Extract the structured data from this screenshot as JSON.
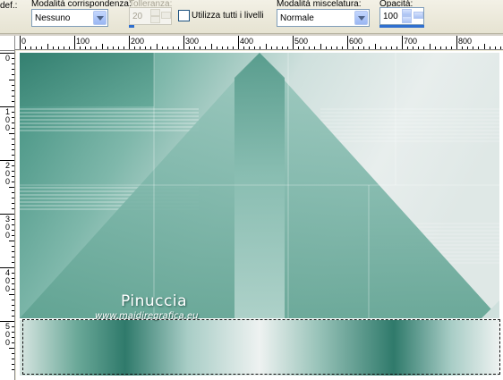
{
  "toolbar": {
    "partial_left_label": "def.:",
    "match_mode": {
      "label": "Modalità corrispondenza:",
      "value": "Nessuno"
    },
    "tolerance": {
      "label": "Tolleranza:",
      "value": "20",
      "enabled": false
    },
    "use_all_layers": {
      "label": "Utilizza tutti i livelli",
      "checked": false
    },
    "blend_mode": {
      "label": "Modalità miscelatura:",
      "value": "Normale"
    },
    "opacity": {
      "label": "Opacità:",
      "value": "100"
    }
  },
  "ruler_h": {
    "labels": [
      "0",
      "100",
      "200",
      "300",
      "400",
      "500",
      "600",
      "700",
      "800"
    ]
  },
  "ruler_v": {
    "labels": [
      [
        "0"
      ],
      [
        "1",
        "0",
        "0"
      ],
      [
        "2",
        "0",
        "0"
      ],
      [
        "3",
        "0",
        "0"
      ],
      [
        "4",
        "0",
        "0"
      ],
      [
        "5",
        "0",
        "0"
      ]
    ]
  },
  "canvas": {
    "watermark_name": "Pinuccia",
    "watermark_url": "www.maidiregrafica.eu",
    "colors": {
      "teal_dark": "#2f7a6b",
      "teal_mid": "#5ea594",
      "teal_light": "#a8cdc6",
      "pale": "#e4ebea"
    }
  }
}
